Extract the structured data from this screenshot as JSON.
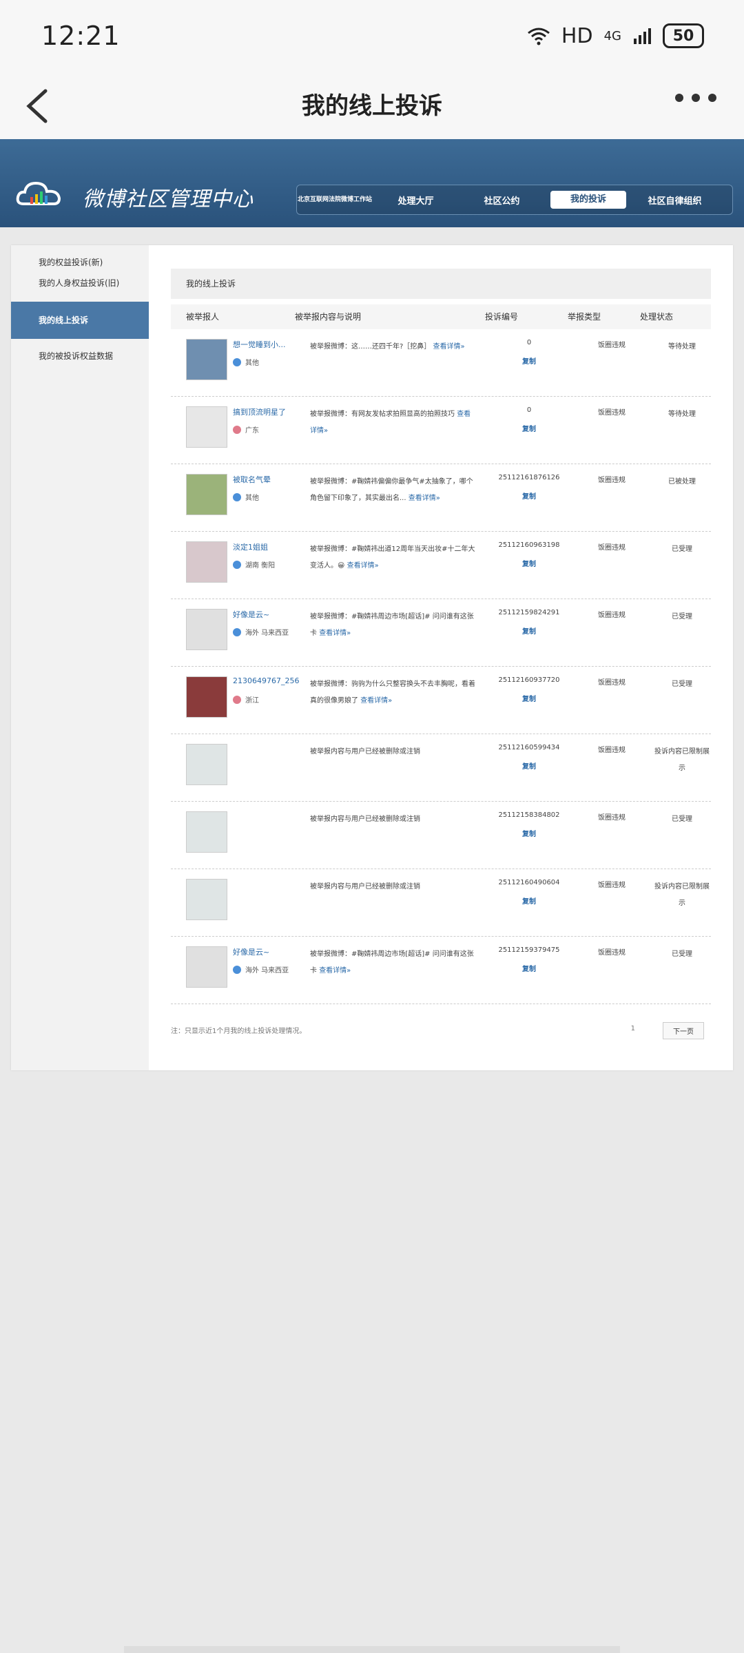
{
  "status": {
    "time": "12:21",
    "hd": "HD",
    "net": "4G",
    "battery": "50"
  },
  "appbar": {
    "title": "我的线上投诉"
  },
  "banner": {
    "brand": "微博社区管理中心",
    "nav": [
      {
        "label": "北京互联网法院微博工作站"
      },
      {
        "label": "处理大厅"
      },
      {
        "label": "社区公约"
      },
      {
        "label": "我的投诉"
      },
      {
        "label": "社区自律组织"
      }
    ]
  },
  "sidebar": {
    "items": [
      {
        "label": "我的权益投诉(新)"
      },
      {
        "label": "我的人身权益投诉(旧)"
      },
      {
        "label": "我的线上投诉"
      },
      {
        "label": "我的被投诉权益数据"
      }
    ]
  },
  "content": {
    "section_title": "我的线上投诉",
    "headers": [
      "被举报人",
      "被举报内容与说明",
      "投诉编号",
      "举报类型",
      "处理状态"
    ],
    "copy_label": "复制",
    "detail_label": "查看详情»",
    "rows": [
      {
        "name": "想一觉睡到小...",
        "loc": "其他",
        "desc": "被举报微博：这……还四千年?［挖鼻］",
        "num": "0",
        "type": "饭圈违规",
        "state": "等待处理"
      },
      {
        "name": "搞到顶流明星了",
        "loc": "广东",
        "desc": "被举报微博：有网友发帖求拍照显高的拍照技巧",
        "num": "0",
        "type": "饭圈违规",
        "state": "等待处理"
      },
      {
        "name": "被取名气晕",
        "loc": "其他",
        "desc": "被举报微博：#鞠婧祎偏偏你最争气#太抽象了，哪个角色留下印象了，其实最出名...",
        "num": "25112161876126",
        "type": "饭圈违规",
        "state": "已被处理"
      },
      {
        "name": "淡定1姐姐",
        "loc": "湖南 衡阳",
        "desc": "被举报微博：#鞠婧祎出道12周年当天出妆#十二年大变活人。😀",
        "num": "25112160963198",
        "type": "饭圈违规",
        "state": "已受理"
      },
      {
        "name": "好像是云~",
        "loc": "海外 马来西亚",
        "desc": "被举报微博：#鞠婧祎周边市场[超话]# 问问谁有这张卡",
        "num": "25112159824291",
        "type": "饭圈违规",
        "state": "已受理"
      },
      {
        "name": "2130649767_256",
        "loc": "浙江",
        "desc": "被举报微博：驹驹为什么只整容换头不去丰胸呢，看着真的很像男娘了",
        "num": "25112160937720",
        "type": "饭圈违规",
        "state": "已受理"
      },
      {
        "name": "",
        "loc": "",
        "desc": "被举报内容与用户已经被删除或注销",
        "num": "25112160599434",
        "type": "饭圈违规",
        "state": "投诉内容已限制展示"
      },
      {
        "name": "",
        "loc": "",
        "desc": "被举报内容与用户已经被删除或注销",
        "num": "25112158384802",
        "type": "饭圈违规",
        "state": "已受理"
      },
      {
        "name": "",
        "loc": "",
        "desc": "被举报内容与用户已经被删除或注销",
        "num": "25112160490604",
        "type": "饭圈违规",
        "state": "投诉内容已限制展示"
      },
      {
        "name": "好像是云~",
        "loc": "海外 马来西亚",
        "desc": "被举报微博：#鞠婧祎周边市场[超话]# 问问谁有这张卡",
        "num": "25112159379475",
        "type": "饭圈违规",
        "state": "已受理"
      }
    ],
    "note": "注：只显示近1个月我的线上投诉处理情况。",
    "page": "1",
    "next": "下一页"
  }
}
